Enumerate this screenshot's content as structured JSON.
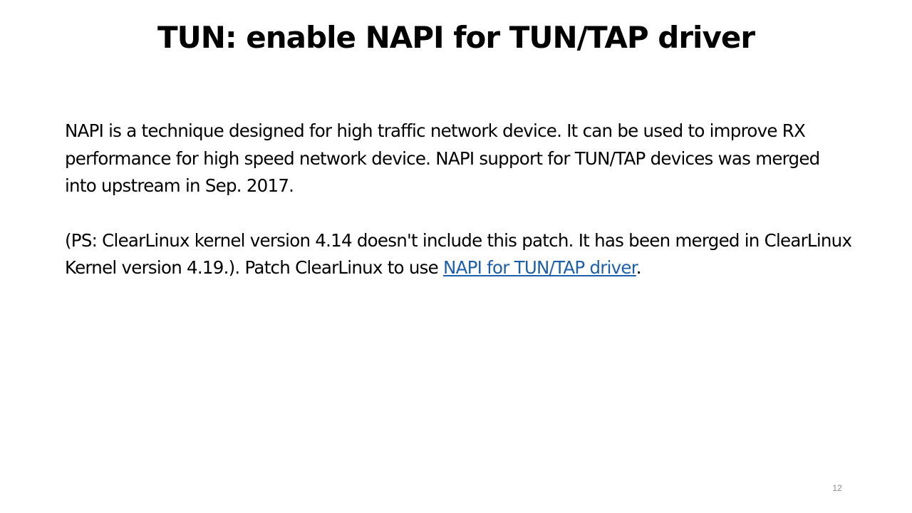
{
  "slide": {
    "title": "TUN: enable NAPI for TUN/TAP driver",
    "paragraphs": [
      {
        "text": "NAPI is a technique designed for high traffic network device. It can be used to improve RX performance for high speed network device. NAPI support for TUN/TAP devices was merged into upstream in Sep. 2017."
      },
      {
        "text_before_link": "(PS: ClearLinux kernel version 4.14 doesn't include this patch. It has been merged in ClearLinux Kernel version 4.19.). Patch ClearLinux to use ",
        "link_text": "NAPI for TUN/TAP driver",
        "text_after_link": "."
      }
    ],
    "slide_number": "12"
  },
  "colors": {
    "background": "#ffffff",
    "text": "#000000",
    "link": "#1f5faa",
    "slide_number": "#8a8a8a"
  }
}
